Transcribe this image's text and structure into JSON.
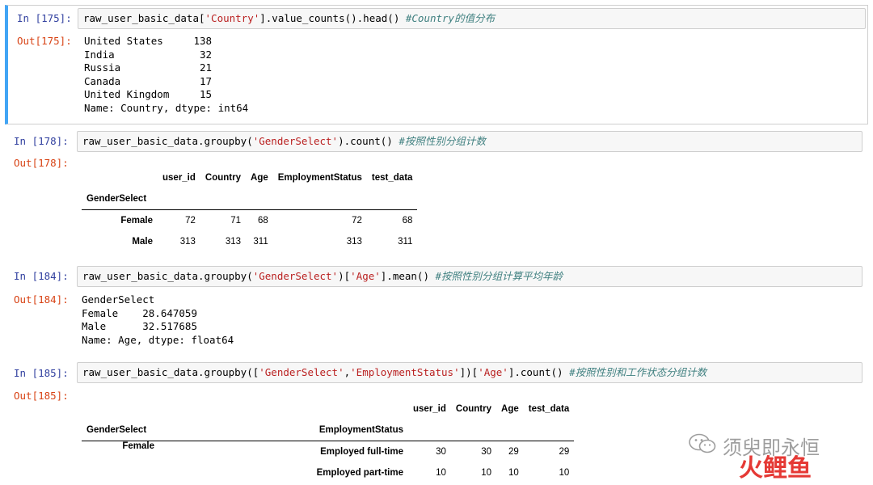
{
  "cells": [
    {
      "in_prompt": "In [175]:",
      "out_prompt": "Out[175]:",
      "code": {
        "pre": "raw_user_basic_data[",
        "s1": "'Country'",
        "post": "].value_counts().head() ",
        "comment": "#Country的值分布"
      },
      "output_lines": [
        "United States     138",
        "India              32",
        "Russia             21",
        "Canada             17",
        "United Kingdom     15",
        "Name: Country, dtype: int64"
      ]
    },
    {
      "in_prompt": "In [178]:",
      "out_prompt": "Out[178]:",
      "code": {
        "pre": "raw_user_basic_data.groupby(",
        "s1": "'GenderSelect'",
        "post": ").count() ",
        "comment": "#按照性别分组计数"
      },
      "table": {
        "columns": [
          "user_id",
          "Country",
          "Age",
          "EmploymentStatus",
          "test_data"
        ],
        "index_name": "GenderSelect",
        "rows": [
          {
            "index": "Female",
            "values": [
              "72",
              "71",
              "68",
              "72",
              "68"
            ]
          },
          {
            "index": "Male",
            "values": [
              "313",
              "313",
              "311",
              "313",
              "311"
            ]
          }
        ]
      }
    },
    {
      "in_prompt": "In [184]:",
      "out_prompt": "Out[184]:",
      "code": {
        "pre": "raw_user_basic_data.groupby(",
        "s1": "'GenderSelect'",
        "mid": ")[",
        "s2": "'Age'",
        "post": "].mean() ",
        "comment": "#按照性别分组计算平均年龄"
      },
      "output_lines": [
        "GenderSelect",
        "Female    28.647059",
        "Male      32.517685",
        "Name: Age, dtype: float64"
      ]
    },
    {
      "in_prompt": "In [185]:",
      "out_prompt": "Out[185]:",
      "code": {
        "pre": "raw_user_basic_data.groupby([",
        "s1": "'GenderSelect'",
        "mid1": ",",
        "s2": "'EmploymentStatus'",
        "mid2": "])[",
        "s3": "'Age'",
        "post": "].count() ",
        "comment": "#按照性别和工作状态分组计数"
      },
      "table": {
        "columns": [
          "user_id",
          "Country",
          "Age",
          "test_data"
        ],
        "index_names": [
          "GenderSelect",
          "EmploymentStatus"
        ],
        "rows": [
          {
            "index0": "Female",
            "index1": "Employed full-time",
            "values": [
              "30",
              "30",
              "29",
              "29"
            ]
          },
          {
            "index0": "",
            "index1": "Employed part-time",
            "values": [
              "10",
              "10",
              "10",
              "10"
            ]
          }
        ]
      }
    }
  ],
  "watermark": {
    "text": "须臾即永恒",
    "brand": "火鲤鱼"
  },
  "colors": {
    "in_prompt": "#303f9f",
    "out_prompt": "#d84315",
    "string": "#ba2121",
    "comment": "#408080",
    "selected_bar": "#42a5f5"
  }
}
